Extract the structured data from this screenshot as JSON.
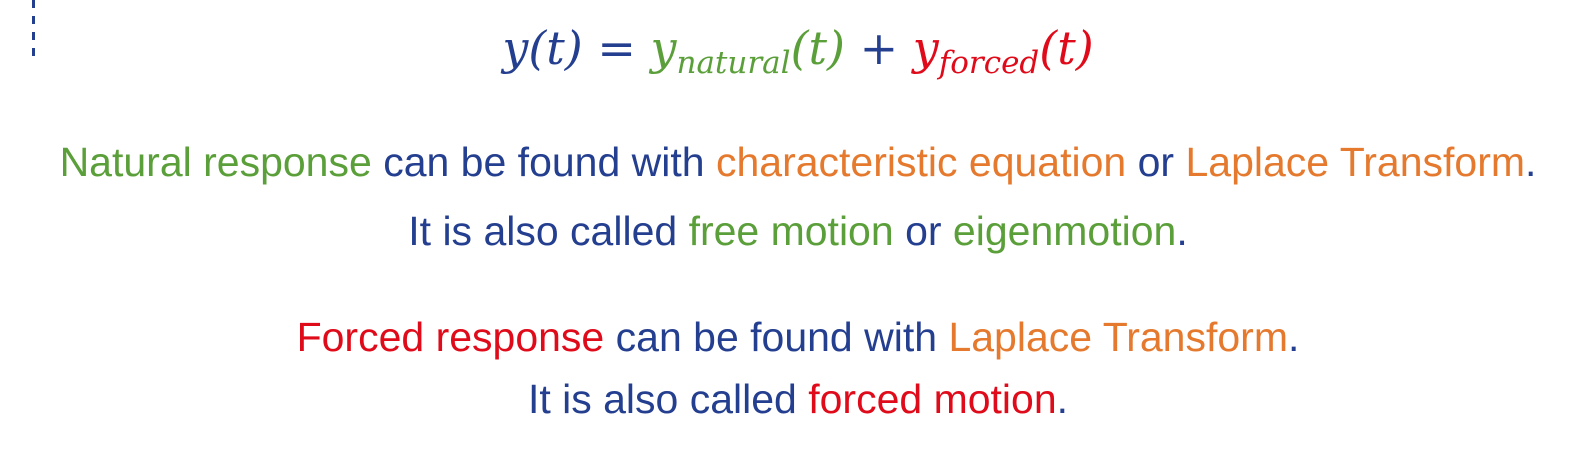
{
  "colors": {
    "blue": "#243f8f",
    "green": "#5b9f3a",
    "orange": "#e57a2e",
    "red": "#e00b1a"
  },
  "equation": {
    "lhs": "y(t) = ",
    "natural_symbol": "y",
    "natural_subscript": "natural",
    "natural_arg": "(t)",
    "plus": " + ",
    "forced_symbol": "y",
    "forced_subscript": "forced",
    "forced_arg": "(t)"
  },
  "natural": {
    "line1": {
      "term": "Natural response",
      "text1": " can be found with ",
      "method1": "characteristic equation",
      "text2": " or ",
      "method2": "Laplace Transform",
      "end": "."
    },
    "line2": {
      "text1": "It is also called ",
      "name1": "free motion",
      "text2": " or ",
      "name2": "eigenmotion",
      "end": "."
    }
  },
  "forced": {
    "line1": {
      "term": "Forced response",
      "text1": " can be found with ",
      "method1": "Laplace Transform",
      "end": "."
    },
    "line2": {
      "text1": "It is also called ",
      "name1": "forced motion",
      "end": "."
    }
  }
}
